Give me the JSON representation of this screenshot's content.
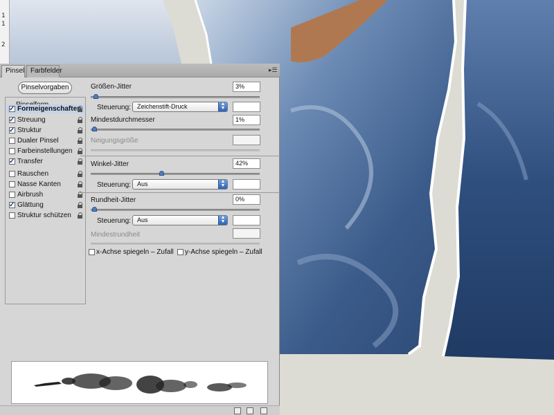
{
  "ruler": {
    "marks": [
      "1",
      "1",
      "2"
    ]
  },
  "panel": {
    "tabs": [
      "Pinsel",
      "Farbfelder"
    ],
    "menu_icon": "panel-menu-icon",
    "presets_button": "Pinselvorgaben",
    "options_header": "Pinselform",
    "options": [
      {
        "label": "Formeigenschaften",
        "checked": true,
        "selected": true
      },
      {
        "label": "Streuung",
        "checked": true
      },
      {
        "label": "Struktur",
        "checked": true
      },
      {
        "label": "Dualer Pinsel",
        "checked": false
      },
      {
        "label": "Farbeinstellungen",
        "checked": false
      },
      {
        "label": "Transfer",
        "checked": true
      },
      {
        "label": "Rauschen",
        "checked": false
      },
      {
        "label": "Nasse Kanten",
        "checked": false
      },
      {
        "label": "Airbrush",
        "checked": false
      },
      {
        "label": "Glättung",
        "checked": true
      },
      {
        "label": "Struktur schützen",
        "checked": false
      }
    ]
  },
  "settings": {
    "size_jitter": {
      "label": "Größen-Jitter",
      "value": "3%",
      "level": 0.03
    },
    "size_control": {
      "label": "Steuerung:",
      "value": "Zeichenstift-Druck"
    },
    "min_diameter": {
      "label": "Mindestdurchmesser",
      "value": "1%",
      "level": 0.01
    },
    "tilt_scale": {
      "label": "Neigungsgröße"
    },
    "angle_jitter": {
      "label": "Winkel-Jitter",
      "value": "42%",
      "level": 0.42
    },
    "angle_control": {
      "label": "Steuerung:",
      "value": "Aus"
    },
    "roundness_jitter": {
      "label": "Rundheit-Jitter",
      "value": "0%",
      "level": 0.0
    },
    "roundness_control": {
      "label": "Steuerung:",
      "value": "Aus"
    },
    "min_roundness": {
      "label": "Mindestrundheit"
    },
    "flip_x": {
      "label": "x-Achse spiegeln – Zufall",
      "checked": false
    },
    "flip_y": {
      "label": "y-Achse spiegeln – Zufall",
      "checked": false
    }
  },
  "colors": {
    "accent": "#4b7fc2",
    "panel": "#d6d6d6",
    "paper": "#dcdcd4",
    "photo": "#33507a"
  }
}
